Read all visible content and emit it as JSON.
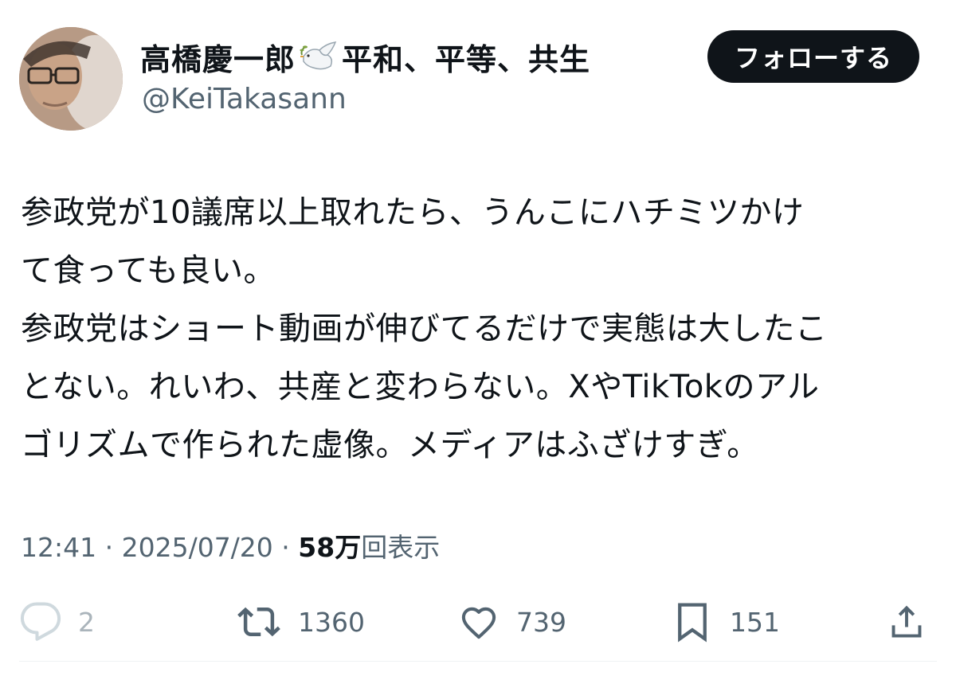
{
  "user": {
    "display_name": "高橋慶一郎",
    "name_suffix": "平和、平等、共生",
    "name_emoji_icon": "dove-of-peace-icon",
    "handle": "@KeiTakasann"
  },
  "follow_button": {
    "label": "フォローする"
  },
  "tweet": {
    "text": "参政党が10議席以上取れたら、うんこにハチミツかけ\nて食っても良い。\n参政党はショート動画が伸びてるだけで実態は大したこ\nとない。れいわ、共産と変わらない。XやTikTokのアル\nゴリズムで作られた虚像。メディアはふざけすぎ。"
  },
  "meta": {
    "time": "12:41",
    "separator": " · ",
    "date": "2025/07/20",
    "views_count": "58万",
    "views_label": "回表示"
  },
  "actions": {
    "reply": {
      "icon": "reply-icon",
      "count": "2"
    },
    "retweet": {
      "icon": "retweet-icon",
      "count": "1360"
    },
    "like": {
      "icon": "heart-icon",
      "count": "739"
    },
    "bookmark": {
      "icon": "bookmark-icon",
      "count": "151"
    },
    "share": {
      "icon": "share-icon"
    }
  },
  "colors": {
    "text": "#0f1419",
    "secondary_text": "#536471",
    "button_bg": "#0f1419",
    "button_text": "#ffffff",
    "divider": "#eff3f4"
  }
}
